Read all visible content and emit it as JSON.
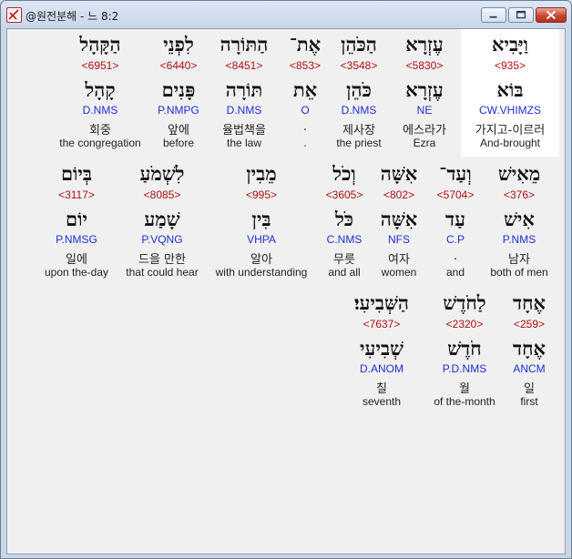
{
  "window": {
    "title": "@원전분해 - 느 8:2"
  },
  "controls": {
    "minimize": "minimize",
    "maximize": "maximize",
    "close": "close"
  },
  "rows": [
    [
      {
        "heb": "וַיָּבִיא",
        "num": "<935>",
        "lemma": "בּוֹא",
        "morph": "CW.VHIMZS",
        "kor": "가지고-이르러",
        "eng": "And-brought"
      },
      {
        "heb": "עֶזְרָא",
        "num": "<5830>",
        "lemma": "עֶזְרָא",
        "morph": "NE",
        "kor": "에스라가",
        "eng": "Ezra"
      },
      {
        "heb": "הַכֹּהֵן",
        "num": "<3548>",
        "lemma": "כֹּהֵן",
        "morph": "D.NMS",
        "kor": "제사장",
        "eng": "the priest"
      },
      {
        "heb": "אֶת־",
        "num": "<853>",
        "lemma": "אֵת",
        "morph": "O",
        "kor": ".",
        "eng": "."
      },
      {
        "heb": "הַתּוֹרָה",
        "num": "<8451>",
        "lemma": "תּוֹרָה",
        "morph": "D.NMS",
        "kor": "율법책을",
        "eng": "the law"
      },
      {
        "heb": "לִפְנֵי",
        "num": "<6440>",
        "lemma": "פָּנִים",
        "morph": "P.NMPG",
        "kor": "앞에",
        "eng": "before"
      },
      {
        "heb": "הַקָּהָל",
        "num": "<6951>",
        "lemma": "קָהָל",
        "morph": "D.NMS",
        "kor": "회중",
        "eng": "the congregation"
      }
    ],
    [
      {
        "heb": "מֵאִישׁ",
        "num": "<376>",
        "lemma": "אִישׁ",
        "morph": "P.NMS",
        "kor": "남자",
        "eng": "both of men"
      },
      {
        "heb": "וְעַד־",
        "num": "<5704>",
        "lemma": "עַד",
        "morph": "C.P",
        "kor": ".",
        "eng": "and"
      },
      {
        "heb": "אִשָּׁה",
        "num": "<802>",
        "lemma": "אִשָּׁה",
        "morph": "NFS",
        "kor": "여자",
        "eng": "women"
      },
      {
        "heb": "וְכֹל",
        "num": "<3605>",
        "lemma": "כֹּל",
        "morph": "C.NMS",
        "kor": "무릇",
        "eng": "and all"
      },
      {
        "heb": "מֵבִין",
        "num": "<995>",
        "lemma": "בִּין",
        "morph": "VHPA",
        "kor": "알아",
        "eng": "with understanding"
      },
      {
        "heb": "לִשְׁמֹעַ",
        "num": "<8085>",
        "lemma": "שָׁמַע",
        "morph": "P.VQNG",
        "kor": "드을 만한",
        "eng": "that could hear"
      },
      {
        "heb": "בְּיוֹם",
        "num": "<3117>",
        "lemma": "יוֹם",
        "morph": "P.NMSG",
        "kor": "일에",
        "eng": "upon the-day"
      }
    ],
    [
      {
        "heb": "אֶחָד",
        "num": "<259>",
        "lemma": "אֶחָד",
        "morph": "ANCM",
        "kor": "일",
        "eng": "first"
      },
      {
        "heb": "לַחֹדֶשׁ",
        "num": "<2320>",
        "lemma": "חֹדֶשׁ",
        "morph": "P.D.NMS",
        "kor": "월",
        "eng": "of the-month"
      },
      {
        "heb": "הַשְּׁבִיעִי׃",
        "num": "<7637>",
        "lemma": "שְׁבִיעִי",
        "morph": "D.ANOM",
        "kor": "칠",
        "eng": "seventh"
      }
    ]
  ]
}
